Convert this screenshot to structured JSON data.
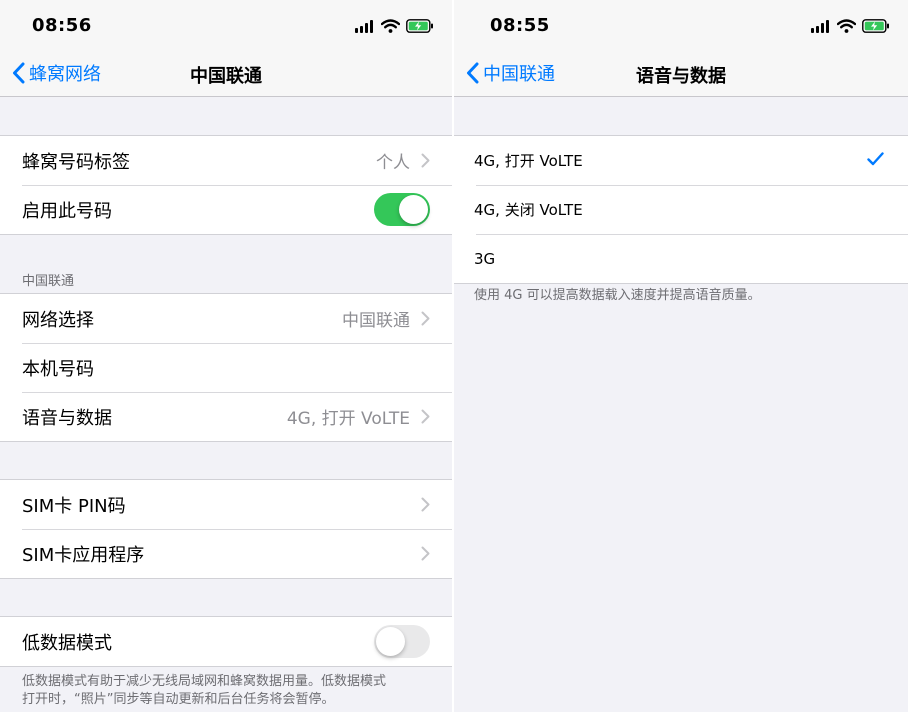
{
  "left": {
    "time": "08:56",
    "nav": {
      "back_label": "蜂窝网络",
      "title": "中国联通"
    },
    "groups": [
      {
        "rows": [
          {
            "label": "蜂窝号码标签",
            "value": "个人"
          },
          {
            "label": "启用此号码",
            "toggle": "on"
          }
        ]
      },
      {
        "header": "中国联通",
        "rows": [
          {
            "label": "网络选择",
            "value": "中国联通"
          },
          {
            "label": "本机号码"
          },
          {
            "label": "语音与数据",
            "value": "4G, 打开 VoLTE"
          }
        ]
      },
      {
        "rows": [
          {
            "label": "SIM卡 PIN码"
          },
          {
            "label": "SIM卡应用程序"
          }
        ]
      },
      {
        "rows": [
          {
            "label": "低数据模式",
            "toggle": "off"
          }
        ],
        "footer_line1": "低数据模式有助于减少无线局域网和蜂窝数据用量。低数据模式",
        "footer_line2": "打开时，“照片”同步等自动更新和后台任务将会暂停。"
      }
    ]
  },
  "right": {
    "time": "08:55",
    "nav": {
      "back_label": "中国联通",
      "title": "语音与数据"
    },
    "options": [
      {
        "label": "4G, 打开 VoLTE",
        "selected": true
      },
      {
        "label": "4G, 关闭 VoLTE",
        "selected": false
      },
      {
        "label": "3G",
        "selected": false
      }
    ],
    "footer": "使用 4G 可以提高数据载入速度并提高语音质量。"
  },
  "colors": {
    "accent": "#007aff",
    "toggle_on": "#34c759",
    "battery": "#34c759"
  },
  "icons": {
    "signal": "signal-bars-icon",
    "wifi": "wifi-icon",
    "battery": "battery-charging-icon",
    "back": "chevron-left-icon",
    "disclosure": "chevron-right-icon",
    "check": "checkmark-icon"
  }
}
